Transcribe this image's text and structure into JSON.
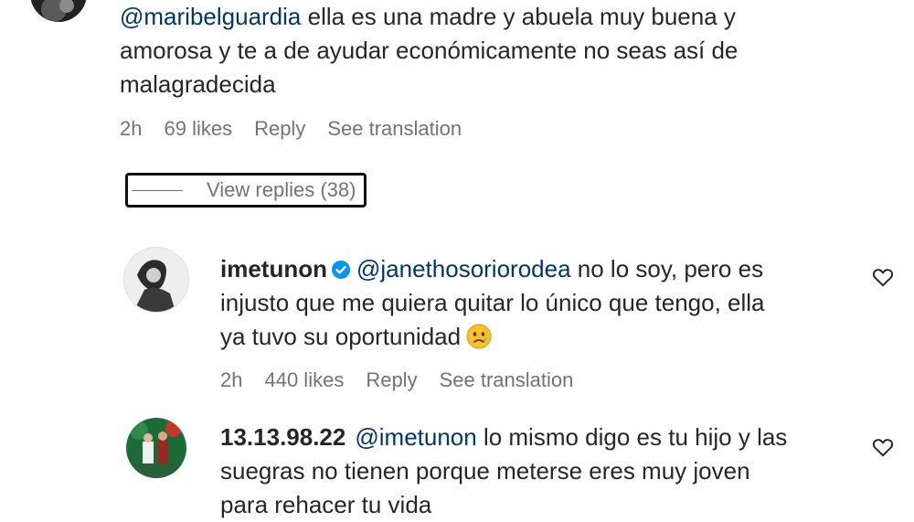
{
  "comment1": {
    "mention": "@maribelguardia",
    "text_line1": " ella es una madre y abuela muy buena y",
    "text_line2": "amorosa y te a de ayudar económicamente no seas así de",
    "text_line3": "malagradecida",
    "time": "2h",
    "likes": "69 likes",
    "reply": "Reply",
    "translate": "See translation",
    "view_replies": "View replies (38)"
  },
  "comment2": {
    "username": "imetunon",
    "verified_icon": "verified-badge-icon",
    "mention": "@janethosoriorodea",
    "text_line1": " no lo soy, pero es",
    "text_line2": "injusto que me quiera quitar lo único que tengo, ella",
    "text_line3": "ya tuvo su oportunidad",
    "emoji": "sad-face-emoji",
    "time": "2h",
    "likes": "440 likes",
    "reply": "Reply",
    "translate": "See translation"
  },
  "comment3": {
    "username": "13.13.98.22",
    "mention": "@imetunon",
    "text_line1": " lo mismo digo es tu hijo y las",
    "text_line2": "suegras no tienen porque meterse eres muy joven",
    "text_line3": "para rehacer tu vida"
  },
  "colors": {
    "text": "#262626",
    "mention": "#00376b",
    "meta": "#737373",
    "verified": "#0095f6"
  }
}
